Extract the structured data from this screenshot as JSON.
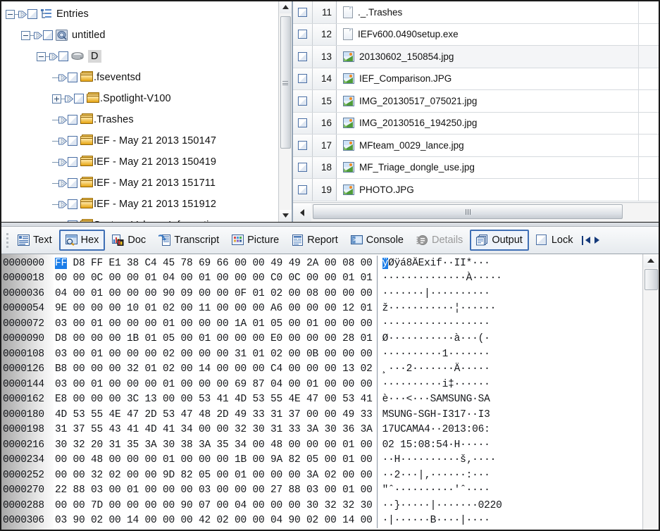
{
  "tree": {
    "title": "Entries",
    "nodes": [
      {
        "label": "Entries",
        "depth": 0,
        "expander": "minus",
        "icon": "entries-icon",
        "selected": false
      },
      {
        "label": "untitled",
        "depth": 1,
        "expander": "minus",
        "icon": "disk-image-icon",
        "selected": false
      },
      {
        "label": "D",
        "depth": 2,
        "expander": "minus",
        "icon": "drive-icon",
        "selected": true
      },
      {
        "label": ".fseventsd",
        "depth": 3,
        "expander": "none",
        "icon": "folder-icon",
        "selected": false
      },
      {
        "label": ".Spotlight-V100",
        "depth": 3,
        "expander": "plus",
        "icon": "folder-icon",
        "selected": false
      },
      {
        "label": ".Trashes",
        "depth": 3,
        "expander": "none",
        "icon": "folder-icon",
        "selected": false
      },
      {
        "label": "IEF - May 21 2013 150147",
        "depth": 3,
        "expander": "none",
        "icon": "folder-icon",
        "selected": false
      },
      {
        "label": "IEF - May 21 2013 150419",
        "depth": 3,
        "expander": "none",
        "icon": "folder-icon",
        "selected": false
      },
      {
        "label": "IEF - May 21 2013 151711",
        "depth": 3,
        "expander": "none",
        "icon": "folder-icon",
        "selected": false
      },
      {
        "label": "IEF - May 21 2013 151912",
        "depth": 3,
        "expander": "none",
        "icon": "folder-icon",
        "selected": false
      },
      {
        "label": "System Volume Information",
        "depth": 3,
        "expander": "none",
        "icon": "folder-icon",
        "selected": false
      }
    ]
  },
  "filelist": {
    "rows": [
      {
        "num": "11",
        "name": "._.Trashes",
        "icon": "document-icon",
        "selected": false
      },
      {
        "num": "12",
        "name": "IEFv600.0490setup.exe",
        "icon": "document-icon",
        "selected": false
      },
      {
        "num": "13",
        "name": "20130602_150854.jpg",
        "icon": "image-icon",
        "selected": true
      },
      {
        "num": "14",
        "name": "IEF_Comparison.JPG",
        "icon": "image-icon",
        "selected": false
      },
      {
        "num": "15",
        "name": "IMG_20130517_075021.jpg",
        "icon": "image-icon",
        "selected": false
      },
      {
        "num": "16",
        "name": "IMG_20130516_194250.jpg",
        "icon": "image-icon",
        "selected": false
      },
      {
        "num": "17",
        "name": "MFteam_0029_lance.jpg",
        "icon": "image-icon",
        "selected": false
      },
      {
        "num": "18",
        "name": "MF_Triage_dongle_use.jpg",
        "icon": "image-icon",
        "selected": false
      },
      {
        "num": "19",
        "name": "PHOTO.JPG",
        "icon": "image-icon",
        "selected": false
      }
    ]
  },
  "tabs": [
    {
      "label": "Text",
      "icon": "text-view-icon",
      "active": false,
      "disabled": false
    },
    {
      "label": "Hex",
      "icon": "hex-view-icon",
      "active": true,
      "disabled": false
    },
    {
      "label": "Doc",
      "icon": "doc-view-icon",
      "active": false,
      "disabled": false
    },
    {
      "label": "Transcript",
      "icon": "transcript-view-icon",
      "active": false,
      "disabled": false
    },
    {
      "label": "Picture",
      "icon": "picture-view-icon",
      "active": false,
      "disabled": false
    },
    {
      "label": "Report",
      "icon": "report-view-icon",
      "active": false,
      "disabled": false
    },
    {
      "label": "Console",
      "icon": "console-view-icon",
      "active": false,
      "disabled": false
    },
    {
      "label": "Details",
      "icon": "details-view-icon",
      "active": false,
      "disabled": true
    },
    {
      "label": "Output",
      "icon": "output-view-icon",
      "active": true,
      "disabled": false
    },
    {
      "label": "Lock",
      "icon": "lock-checkbox-icon",
      "active": false,
      "disabled": false
    }
  ],
  "hex": {
    "highlight_offset": 0,
    "rows": [
      {
        "offset": "0000000",
        "bytes": "FF D8 FF E1 38 C4 45 78 69 66 00 00 49 49 2A 00 08 00",
        "ascii": "ÿØÿá8ÄExif··II*···"
      },
      {
        "offset": "0000018",
        "bytes": "00 00 0C 00 00 01 04 00 01 00 00 00 C0 0C 00 00 01 01",
        "ascii": "··············À·····"
      },
      {
        "offset": "0000036",
        "bytes": "04 00 01 00 00 00 90 09 00 00 0F 01 02 00 08 00 00 00",
        "ascii": "·······|··········"
      },
      {
        "offset": "0000054",
        "bytes": "9E 00 00 00 10 01 02 00 11 00 00 00 A6 00 00 00 12 01",
        "ascii": "ž···········¦······"
      },
      {
        "offset": "0000072",
        "bytes": "03 00 01 00 00 00 01 00 00 00 1A 01 05 00 01 00 00 00",
        "ascii": "··················"
      },
      {
        "offset": "0000090",
        "bytes": "D8 00 00 00 1B 01 05 00 01 00 00 00 E0 00 00 00 28 01",
        "ascii": "Ø···········à···(·"
      },
      {
        "offset": "0000108",
        "bytes": "03 00 01 00 00 00 02 00 00 00 31 01 02 00 0B 00 00 00",
        "ascii": "··········1·······"
      },
      {
        "offset": "0000126",
        "bytes": "B8 00 00 00 32 01 02 00 14 00 00 00 C4 00 00 00 13 02",
        "ascii": "¸···2·······Ä·····"
      },
      {
        "offset": "0000144",
        "bytes": "03 00 01 00 00 00 01 00 00 00 69 87 04 00 01 00 00 00",
        "ascii": "··········i‡······"
      },
      {
        "offset": "0000162",
        "bytes": "E8 00 00 00 3C 13 00 00 53 41 4D 53 55 4E 47 00 53 41",
        "ascii": "è···<···SAMSUNG·SA"
      },
      {
        "offset": "0000180",
        "bytes": "4D 53 55 4E 47 2D 53 47 48 2D 49 33 31 37 00 00 49 33",
        "ascii": "MSUNG-SGH-I317··I3"
      },
      {
        "offset": "0000198",
        "bytes": "31 37 55 43 41 4D 41 34 00 00 32 30 31 33 3A 30 36 3A",
        "ascii": "17UCAMA4··2013:06:"
      },
      {
        "offset": "0000216",
        "bytes": "30 32 20 31 35 3A 30 38 3A 35 34 00 48 00 00 00 01 00",
        "ascii": "02 15:08:54·H·····"
      },
      {
        "offset": "0000234",
        "bytes": "00 00 48 00 00 00 01 00 00 00 1B 00 9A 82 05 00 01 00",
        "ascii": "··H··········š‚····"
      },
      {
        "offset": "0000252",
        "bytes": "00 00 32 02 00 00 9D 82 05 00 01 00 00 00 3A 02 00 00",
        "ascii": "··2···|‚······:···"
      },
      {
        "offset": "0000270",
        "bytes": "22 88 03 00 01 00 00 00 03 00 00 00 27 88 03 00 01 00",
        "ascii": "\"ˆ··········'ˆ····"
      },
      {
        "offset": "0000288",
        "bytes": "00 00 7D 00 00 00 00 90 07 00 04 00 00 00 30 32 32 30",
        "ascii": "··}·····|·······0220"
      },
      {
        "offset": "0000306",
        "bytes": "03 90 02 00 14 00 00 00 42 02 00 00 04 90 02 00 14 00",
        "ascii": "·|······B····|····"
      }
    ]
  }
}
